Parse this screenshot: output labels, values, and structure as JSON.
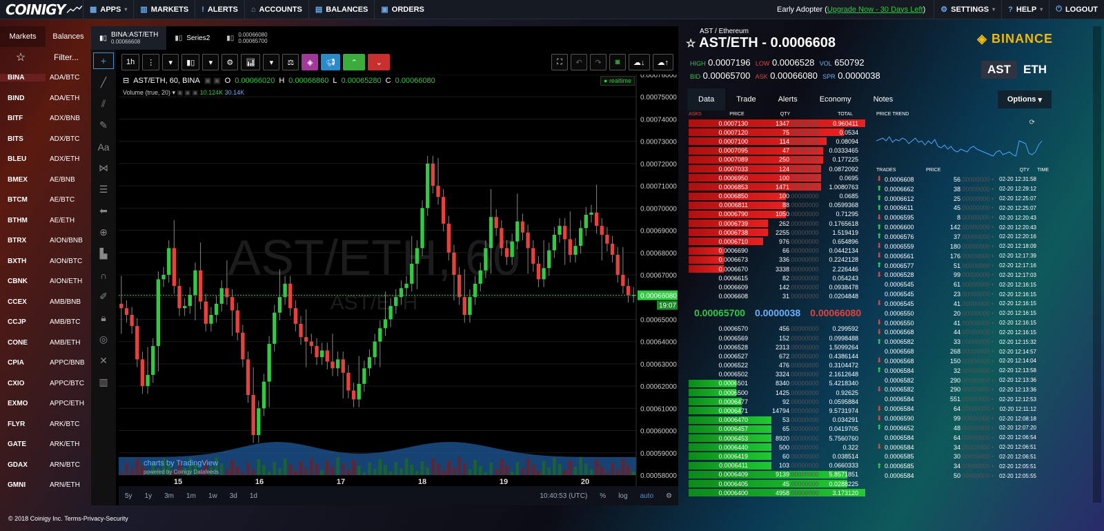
{
  "topbar": {
    "logo": "COINIGY",
    "nav": [
      "APPS",
      "MARKETS",
      "ALERTS",
      "ACCOUNTS",
      "BALANCES",
      "ORDERS"
    ],
    "early_adopter": "Early Adopter (",
    "upgrade": "Upgrade Now - 30 Days Left",
    "early_close": ")",
    "right": [
      "SETTINGS",
      "HELP",
      "LOGOUT"
    ]
  },
  "sidebar": {
    "tabs": [
      "Markets",
      "Balances"
    ],
    "filter": "Filter...",
    "rows": [
      [
        "BINA",
        "ADA/BTC"
      ],
      [
        "BIND",
        "ADA/ETH"
      ],
      [
        "BITF",
        "ADX/BNB"
      ],
      [
        "BITS",
        "ADX/BTC"
      ],
      [
        "BLEU",
        "ADX/ETH"
      ],
      [
        "BMEX",
        "AE/BNB"
      ],
      [
        "BTCM",
        "AE/BTC"
      ],
      [
        "BTHM",
        "AE/ETH"
      ],
      [
        "BTRX",
        "AION/BNB"
      ],
      [
        "BXTH",
        "AION/BTC"
      ],
      [
        "CBNK",
        "AION/ETH"
      ],
      [
        "CCEX",
        "AMB/BNB"
      ],
      [
        "CCJP",
        "AMB/BTC"
      ],
      [
        "CONE",
        "AMB/ETH"
      ],
      [
        "CPIA",
        "APPC/BNB"
      ],
      [
        "CXIO",
        "APPC/BTC"
      ],
      [
        "EXMO",
        "APPC/ETH"
      ],
      [
        "FLYR",
        "ARK/BTC"
      ],
      [
        "GATE",
        "ARK/ETH"
      ],
      [
        "GDAX",
        "ARN/BTC"
      ],
      [
        "GMNI",
        "ARN/ETH"
      ]
    ]
  },
  "chart_tabs": {
    "main": "BINA:AST/ETH",
    "main_sub": "0.00066608",
    "series": "Series2",
    "s3a": "0.00066080",
    "s3b": "0.00065700"
  },
  "toolbar": {
    "interval": "1h"
  },
  "legend": {
    "symbol": "AST/ETH, 60, BINA",
    "o_label": "O",
    "o": "0.00066020",
    "h_label": "H",
    "h": "0.00066860",
    "l_label": "L",
    "l": "0.00065280",
    "c_label": "C",
    "c": "0.00066080",
    "volume": "Volume (true, 20)",
    "v1": "10.124K",
    "v2": "30.14K",
    "realtime": "realtime"
  },
  "watermark": {
    "big": "AST/ETH, 60",
    "small": "AST/ETH"
  },
  "price_axis": [
    "0.00076000",
    "0.00075000",
    "0.00074000",
    "0.00073000",
    "0.00072000",
    "0.00071000",
    "0.00070000",
    "0.00069000",
    "0.00068000",
    "0.00067000",
    "0.00066000",
    "0.00065000",
    "0.00064000",
    "0.00063000",
    "0.00062000",
    "0.00061000",
    "0.00060000",
    "0.00059000",
    "0.00058000"
  ],
  "last_price_tag": "0.00066080",
  "countdown": "19:07",
  "time_axis": [
    "15",
    "16",
    "17",
    "18",
    "19",
    "20"
  ],
  "tv_credit": "charts by TradingView",
  "tv_sub": "powered by Coinigy Datafeeds",
  "bottom": {
    "ranges": [
      "5y",
      "1y",
      "3m",
      "1m",
      "1w",
      "3d",
      "1d"
    ],
    "clock": "10:40:53 (UTC)",
    "pct": "%",
    "log": "log",
    "auto": "auto"
  },
  "pair": {
    "sub": "AST / Ethereum",
    "title": "AST/ETH - 0.0006608",
    "exchange": "BINANCE",
    "base": "AST",
    "quote": "ETH"
  },
  "stats": {
    "high_l": "HIGH",
    "high": "0.0007196",
    "low_l": "LOW",
    "low": "0.0006528",
    "vol_l": "VOL",
    "vol": "650792",
    "bid_l": "BID",
    "bid": "0.00065700",
    "ask_l": "ASK",
    "ask": "0.00066080",
    "spr_l": "SPR",
    "spr": "0.0000038"
  },
  "panel_tabs": [
    "Data",
    "Trade",
    "Alerts",
    "Economy",
    "Notes"
  ],
  "options": "Options",
  "book": {
    "headers": [
      "ASKS",
      "PRICE",
      "QTY",
      "TOTAL"
    ],
    "asks": [
      [
        "0.0007130",
        "1347",
        "0.960411",
        1.0
      ],
      [
        "0.0007120",
        "75",
        "0.0534",
        0.88
      ],
      [
        "0.0007100",
        "114",
        "0.08094",
        0.78
      ],
      [
        "0.0007095",
        "47",
        "0.0333465",
        0.76
      ],
      [
        "0.0007089",
        "250",
        "0.177225",
        0.76
      ],
      [
        "0.0007033",
        "124",
        "0.0872092",
        0.75
      ],
      [
        "0.0006950",
        "100",
        "0.0695",
        0.75
      ],
      [
        "0.0006853",
        "1471",
        "1.0080763",
        0.75
      ],
      [
        "0.0006850",
        "100",
        "0.0685",
        0.55
      ],
      [
        "0.0006811",
        "88",
        "0.0599368",
        0.55
      ],
      [
        "0.0006790",
        "1050",
        "0.71295",
        0.55
      ],
      [
        "0.0006739",
        "262",
        "0.1765618",
        0.45
      ],
      [
        "0.0006738",
        "2255",
        "1.519419",
        0.45
      ],
      [
        "0.0006710",
        "976",
        "0.654896",
        0.42
      ],
      [
        "0.0006690",
        "66",
        "0.0442134",
        0.2
      ],
      [
        "0.0006673",
        "336",
        "0.2242128",
        0.2
      ],
      [
        "0.0006670",
        "3338",
        "2.226446",
        0.2
      ],
      [
        "0.0006615",
        "82",
        "0.054243",
        0.0
      ],
      [
        "0.0006609",
        "142",
        "0.0938478",
        0.0
      ],
      [
        "0.0006608",
        "31",
        "0.0204848",
        0.0
      ]
    ],
    "spread": [
      "0.00065700",
      "0.0000038",
      "0.00066080"
    ],
    "bids": [
      [
        "0.0006570",
        "456",
        "0.299592",
        0.0
      ],
      [
        "0.0006569",
        "152",
        "0.0998488",
        0.0
      ],
      [
        "0.0006528",
        "2313",
        "1.5099264",
        0.0
      ],
      [
        "0.0006527",
        "672",
        "0.4386144",
        0.0
      ],
      [
        "0.0006522",
        "476",
        "0.3104472",
        0.0
      ],
      [
        "0.0006502",
        "3324",
        "2.1612648",
        0.0
      ],
      [
        "0.0006501",
        "8340",
        "5.4218340",
        0.27
      ],
      [
        "0.0006500",
        "1425",
        "0.92625",
        0.27
      ],
      [
        "0.0006477",
        "92",
        "0.0595884",
        0.3
      ],
      [
        "0.0006471",
        "14794",
        "9.5731974",
        0.3
      ],
      [
        "0.0006470",
        "53",
        "0.034291",
        0.47
      ],
      [
        "0.0006457",
        "65",
        "0.0419705",
        0.47
      ],
      [
        "0.0006453",
        "8920",
        "5.7560760",
        0.47
      ],
      [
        "0.0006440",
        "500",
        "0.322",
        0.47
      ],
      [
        "0.0006419",
        "60",
        "0.038514",
        0.47
      ],
      [
        "0.0006411",
        "103",
        "0.0660333",
        0.47
      ],
      [
        "0.0006409",
        "9139",
        "5.8571851",
        0.9
      ],
      [
        "0.0006405",
        "45",
        "0.0288225",
        0.9
      ],
      [
        "0.0006400",
        "4958",
        "3.173120",
        1.0
      ]
    ]
  },
  "trend": {
    "title": "PRICE TREND",
    "headers": [
      "TRADES",
      "PRICE",
      "QTY",
      "TIME"
    ],
    "rows": [
      [
        "d",
        "0.0006608",
        "56",
        "02-20 12:31:58"
      ],
      [
        "u",
        "0.0006662",
        "38",
        "02-20 12:29:12"
      ],
      [
        "u",
        "0.0006612",
        "25",
        "02-20 12:25:07"
      ],
      [
        "u",
        "0.0006611",
        "45",
        "02-20 12:25:07"
      ],
      [
        "d",
        "0.0006595",
        "8",
        "02-20 12:20:43"
      ],
      [
        "u",
        "0.0006600",
        "142",
        "02-20 12:20:43"
      ],
      [
        "u",
        "0.0006576",
        "37",
        "02-20 12:20:16"
      ],
      [
        "d",
        "0.0006559",
        "180",
        "02-20 12:18:09"
      ],
      [
        "d",
        "0.0006561",
        "176",
        "02-20 12:17:39"
      ],
      [
        "u",
        "0.0006577",
        "51",
        "02-20 12:17:16"
      ],
      [
        "d",
        "0.0006528",
        "99",
        "02-20 12:17:03"
      ],
      [
        "n",
        "0.0006545",
        "61",
        "02-20 12:16:15"
      ],
      [
        "n",
        "0.0006545",
        "23",
        "02-20 12:16:15"
      ],
      [
        "d",
        "0.0006545",
        "41",
        "02-20 12:16:15"
      ],
      [
        "n",
        "0.0006550",
        "20",
        "02-20 12:16:15"
      ],
      [
        "d",
        "0.0006550",
        "41",
        "02-20 12:16:15"
      ],
      [
        "d",
        "0.0006568",
        "44",
        "02-20 12:16:15"
      ],
      [
        "u",
        "0.0006582",
        "33",
        "02-20 12:15:32"
      ],
      [
        "n",
        "0.0006568",
        "268",
        "02-20 12:14:57"
      ],
      [
        "d",
        "0.0006568",
        "150",
        "02-20 12:14:04"
      ],
      [
        "u",
        "0.0006584",
        "32",
        "02-20 12:13:58"
      ],
      [
        "n",
        "0.0006582",
        "290",
        "02-20 12:13:36"
      ],
      [
        "d",
        "0.0006582",
        "290",
        "02-20 12:13:36"
      ],
      [
        "n",
        "0.0006584",
        "551",
        "02-20 12:12:53"
      ],
      [
        "d",
        "0.0006584",
        "64",
        "02-20 12:11:12"
      ],
      [
        "d",
        "0.0006590",
        "99",
        "02-20 12:08:18"
      ],
      [
        "u",
        "0.0006652",
        "48",
        "02-20 12:07:20"
      ],
      [
        "n",
        "0.0006584",
        "64",
        "02-20 12:06:54"
      ],
      [
        "d",
        "0.0006584",
        "34",
        "02-20 12:06:51"
      ],
      [
        "n",
        "0.0006585",
        "30",
        "02-20 12:06:51"
      ],
      [
        "u",
        "0.0006585",
        "34",
        "02-20 12:05:51"
      ],
      [
        "n",
        "0.0006584",
        "50",
        "02-20 12:05:55"
      ]
    ]
  },
  "footer": {
    "copy": "© 2018 Coinigy Inc.",
    "terms": "Terms",
    "sep1": " - ",
    "privacy": "Privacy",
    "sep2": " - ",
    "security": "Security"
  },
  "chart_data": {
    "type": "candlestick",
    "symbol": "AST/ETH",
    "interval": "60",
    "ylim": [
      0.00058,
      0.00076
    ],
    "x_ticks": [
      "15",
      "16",
      "17",
      "18",
      "19",
      "20"
    ],
    "closes": [
      0.000655,
      0.000652,
      0.000647,
      0.000632,
      0.00062,
      0.000625,
      0.000638,
      0.000668,
      0.00067,
      0.000682,
      0.000665,
      0.000655,
      0.000656,
      0.000661,
      0.000672,
      0.000658,
      0.000648,
      0.000652,
      0.000657,
      0.000664,
      0.00066,
      0.000654,
      0.000644,
      0.000632,
      0.000616,
      0.000598,
      0.00061,
      0.000622,
      0.000639,
      0.000653,
      0.00066,
      0.000666,
      0.000655,
      0.000648,
      0.000642,
      0.00064,
      0.000638,
      0.000633,
      0.000636,
      0.000631,
      0.000628,
      0.000632,
      0.000626,
      0.000618,
      0.000614,
      0.000621,
      0.000628,
      0.000633,
      0.00064,
      0.000646,
      0.00065,
      0.000656,
      0.00066,
      0.000664,
      0.000666,
      0.000675,
      0.000682,
      0.0007,
      0.00072,
      0.00071,
      0.000705,
      0.000693,
      0.00068,
      0.00067,
      0.00066,
      0.000652,
      0.00066,
      0.000666,
      0.000672,
      0.000682,
      0.000696,
      0.000691,
      0.000682,
      0.000678,
      0.000685,
      0.000694,
      0.000689,
      0.000682,
      0.000675,
      0.000668,
      0.000673,
      0.000681,
      0.000688,
      0.000692,
      0.000686,
      0.000679,
      0.000683,
      0.000691,
      0.000697,
      0.000698,
      0.000692,
      0.000688,
      0.000684,
      0.000679,
      0.00067,
      0.000665,
      0.000661,
      0.000661
    ],
    "volume": "area + bars"
  }
}
